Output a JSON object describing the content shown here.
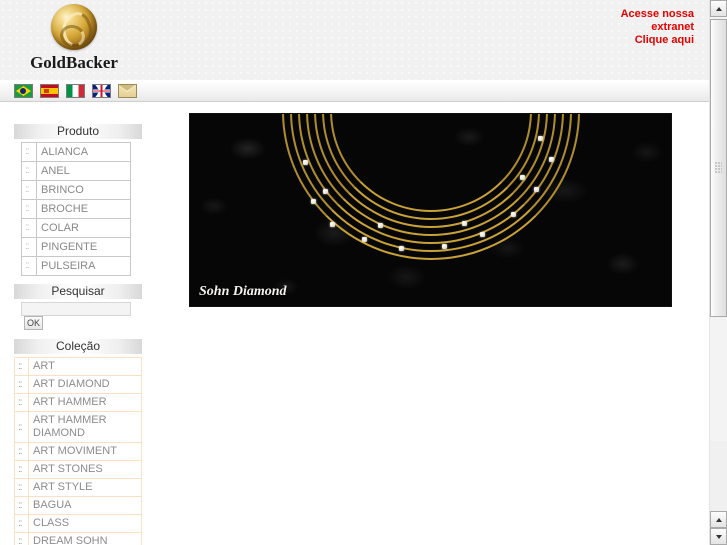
{
  "brand": {
    "name": "GoldBacker",
    "logo_icon": "gold-orb-icon"
  },
  "extranet": {
    "line1": "Acesse nossa",
    "line2": "extranet",
    "line3": "Clique aqui",
    "color": "#e60000"
  },
  "languages": [
    {
      "code": "br",
      "label": "Português (Brasil)",
      "icon": "flag-brazil-icon"
    },
    {
      "code": "es",
      "label": "Español",
      "icon": "flag-spain-icon"
    },
    {
      "code": "it",
      "label": "Italiano",
      "icon": "flag-italy-icon"
    },
    {
      "code": "gb",
      "label": "English",
      "icon": "flag-uk-icon"
    },
    {
      "code": "mail",
      "label": "Contato",
      "icon": "envelope-icon"
    }
  ],
  "sidebar": {
    "produto": {
      "title": "Produto",
      "bullet": "::",
      "items": [
        "ALIANCA",
        "ANEL",
        "BRINCO",
        "BROCHE",
        "COLAR",
        "PINGENTE",
        "PULSEIRA"
      ]
    },
    "search": {
      "title": "Pesquisar",
      "value": "",
      "placeholder": "",
      "button_label": "OK"
    },
    "colecao": {
      "title": "Coleção",
      "bullet": "::",
      "items": [
        "ART",
        "ART DIAMOND",
        "ART HAMMER",
        "ART HAMMER DIAMOND",
        "ART MOVIMENT",
        "ART STONES",
        "ART STYLE",
        "BAGUA",
        "CLASS",
        "DREAM SOHN"
      ]
    }
  },
  "main": {
    "photo": {
      "caption": "Sohn Diamond",
      "alt": "gold-necklace-photo",
      "background_color": "#060606",
      "gold_color": "#c9a236"
    }
  },
  "scrollbar": {
    "up_icon": "arrow-up-icon",
    "down_icon": "arrow-down-icon"
  }
}
